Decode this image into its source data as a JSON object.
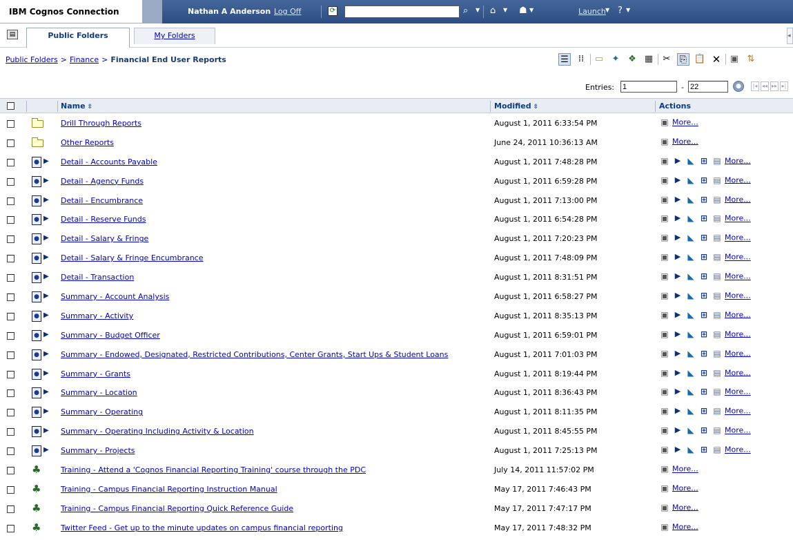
{
  "banner": {
    "brand": "IBM Cognos Connection",
    "user": "Nathan A Anderson",
    "logoff": "Log Off",
    "search_value": "",
    "launch": "Launch",
    "help_icon": "?"
  },
  "tabs": {
    "public": "Public Folders",
    "my": "My Folders"
  },
  "breadcrumb": {
    "items": [
      "Public Folders",
      "Finance"
    ],
    "separator": ">",
    "current": "Financial End User Reports"
  },
  "entries": {
    "label": "Entries:",
    "from": "1",
    "dash": "-",
    "to": "22"
  },
  "table": {
    "columns": {
      "name": "Name",
      "modified": "Modified",
      "actions": "Actions"
    },
    "more_label": "More...",
    "rows": [
      {
        "type": "folder",
        "name": "Drill Through Reports",
        "modified": "August 1, 2011 6:33:54 PM"
      },
      {
        "type": "folder",
        "name": "Other Reports",
        "modified": "June 24, 2011 10:36:13 AM"
      },
      {
        "type": "report",
        "name": "Detail - Accounts Payable",
        "modified": "August 1, 2011 7:48:28 PM"
      },
      {
        "type": "report",
        "name": "Detail - Agency Funds",
        "modified": "August 1, 2011 6:59:28 PM"
      },
      {
        "type": "report",
        "name": "Detail - Encumbrance",
        "modified": "August 1, 2011 7:13:00 PM"
      },
      {
        "type": "report",
        "name": "Detail - Reserve Funds",
        "modified": "August 1, 2011 6:54:28 PM"
      },
      {
        "type": "report",
        "name": "Detail - Salary & Fringe",
        "modified": "August 1, 2011 7:20:23 PM"
      },
      {
        "type": "report",
        "name": "Detail - Salary & Fringe Encumbrance",
        "modified": "August 1, 2011 7:48:09 PM"
      },
      {
        "type": "report",
        "name": "Detail - Transaction",
        "modified": "August 1, 2011 8:31:51 PM"
      },
      {
        "type": "report",
        "name": "Summary - Account Analysis",
        "modified": "August 1, 2011 6:58:27 PM"
      },
      {
        "type": "report",
        "name": "Summary - Activity",
        "modified": "August 1, 2011 8:35:13 PM"
      },
      {
        "type": "report",
        "name": "Summary - Budget Officer",
        "modified": "August 1, 2011 6:59:01 PM"
      },
      {
        "type": "report",
        "name": "Summary - Endowed, Designated, Restricted Contributions, Center Grants, Start Ups & Student Loans",
        "modified": "August 1, 2011 7:01:03 PM"
      },
      {
        "type": "report",
        "name": "Summary - Grants",
        "modified": "August 1, 2011 8:19:44 PM"
      },
      {
        "type": "report",
        "name": "Summary - Location",
        "modified": "August 1, 2011 8:36:43 PM"
      },
      {
        "type": "report",
        "name": "Summary - Operating",
        "modified": "August 1, 2011 8:11:35 PM"
      },
      {
        "type": "report",
        "name": "Summary - Operating Including Activity & Location",
        "modified": "August 1, 2011 8:45:55 PM"
      },
      {
        "type": "report",
        "name": "Summary - Projects",
        "modified": "August 1, 2011 7:25:13 PM"
      },
      {
        "type": "url",
        "name": "Training - Attend a 'Cognos Financial Reporting Training' course through the PDC",
        "modified": "July 14, 2011 11:57:02 PM"
      },
      {
        "type": "url",
        "name": "Training - Campus Financial Reporting Instruction Manual",
        "modified": "May 17, 2011 7:46:43 PM"
      },
      {
        "type": "url",
        "name": "Training - Campus Financial Reporting Quick Reference Guide",
        "modified": "May 17, 2011 7:47:17 PM"
      },
      {
        "type": "url",
        "name": "Twitter Feed - Get up to the minute updates on campus financial reporting",
        "modified": "May 17, 2011 7:48:32 PM"
      }
    ]
  }
}
